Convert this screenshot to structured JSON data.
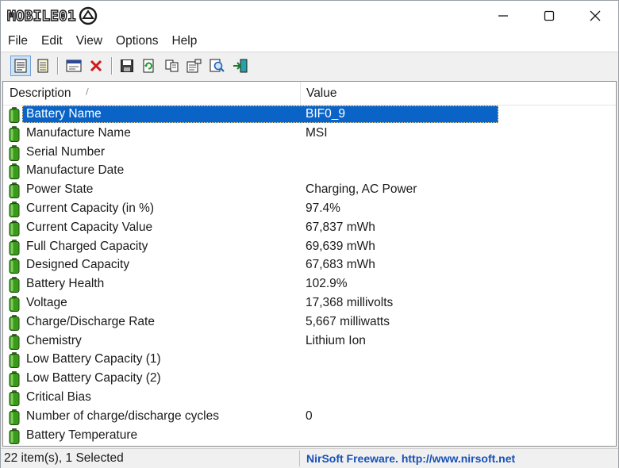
{
  "window": {
    "title_logo": "MOBILE01",
    "controls": {
      "minimize_icon": "minimize-icon",
      "maximize_icon": "maximize-icon",
      "close_icon": "close-icon"
    }
  },
  "menu": [
    "File",
    "Edit",
    "View",
    "Options",
    "Help"
  ],
  "toolbar": {
    "buttons": [
      {
        "icon": "properties-icon",
        "active": true
      },
      {
        "icon": "html-report-icon",
        "active": false
      },
      {
        "icon": "window-icon",
        "active": false
      },
      {
        "icon": "delete-icon",
        "active": false
      },
      {
        "icon": "save-icon",
        "active": false
      },
      {
        "icon": "refresh-icon",
        "active": false
      },
      {
        "icon": "copy-icon",
        "active": false
      },
      {
        "icon": "properties-dialog-icon",
        "active": false
      },
      {
        "icon": "find-icon",
        "active": false
      },
      {
        "icon": "exit-icon",
        "active": false
      }
    ]
  },
  "list": {
    "columns": [
      "Description",
      "Value"
    ],
    "sort_indicator": "/",
    "rows": [
      {
        "description": "Battery Name",
        "value": "BIF0_9",
        "selected": true
      },
      {
        "description": "Manufacture Name",
        "value": "MSI",
        "selected": false
      },
      {
        "description": "Serial Number",
        "value": "",
        "selected": false
      },
      {
        "description": "Manufacture Date",
        "value": "",
        "selected": false
      },
      {
        "description": "Power State",
        "value": "Charging, AC Power",
        "selected": false
      },
      {
        "description": "Current Capacity (in %)",
        "value": "97.4%",
        "selected": false
      },
      {
        "description": "Current Capacity Value",
        "value": "67,837 mWh",
        "selected": false
      },
      {
        "description": "Full Charged Capacity",
        "value": "69,639 mWh",
        "selected": false
      },
      {
        "description": "Designed Capacity",
        "value": "67,683 mWh",
        "selected": false
      },
      {
        "description": "Battery Health",
        "value": "102.9%",
        "selected": false
      },
      {
        "description": "Voltage",
        "value": "17,368 millivolts",
        "selected": false
      },
      {
        "description": "Charge/Discharge Rate",
        "value": "5,667 milliwatts",
        "selected": false
      },
      {
        "description": "Chemistry",
        "value": "Lithium Ion",
        "selected": false
      },
      {
        "description": "Low Battery Capacity (1)",
        "value": "",
        "selected": false
      },
      {
        "description": "Low Battery Capacity (2)",
        "value": "",
        "selected": false
      },
      {
        "description": "Critical Bias",
        "value": "",
        "selected": false
      },
      {
        "description": "Number of charge/discharge cycles",
        "value": "0",
        "selected": false
      },
      {
        "description": "Battery Temperature",
        "value": "",
        "selected": false
      }
    ],
    "row_icon": "battery-icon"
  },
  "status": {
    "count_text": "22 item(s), 1 Selected",
    "link_text": "NirSoft Freeware.  http://www.nirsoft.net"
  },
  "colors": {
    "selection": "#0a64c8",
    "battery_green": "#3a9a1c",
    "link_blue": "#1650b8",
    "delete_red": "#d01818"
  }
}
